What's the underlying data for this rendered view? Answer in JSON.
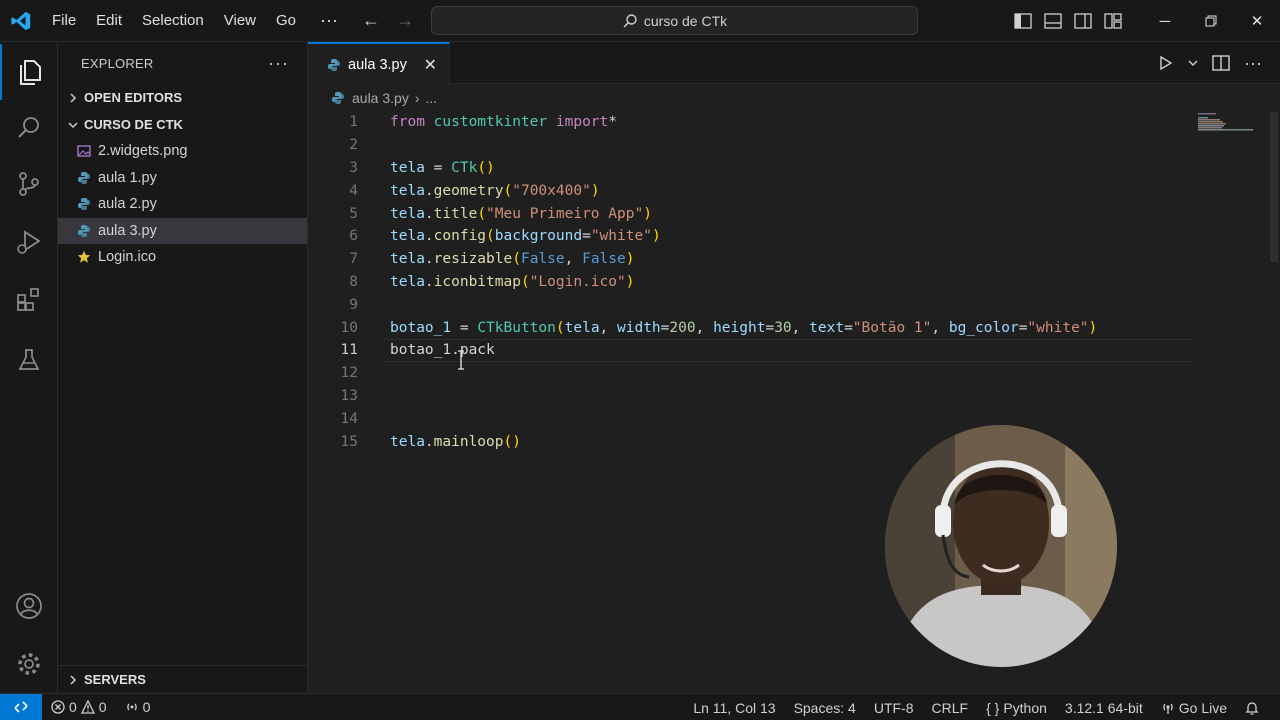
{
  "menu": {
    "items": [
      "File",
      "Edit",
      "Selection",
      "View",
      "Go"
    ],
    "more": "···"
  },
  "search": {
    "text": "curso de CTk"
  },
  "sidebar": {
    "title": "EXPLORER",
    "more": "···",
    "sections": {
      "open_editors": "OPEN EDITORS",
      "folder": "CURSO DE CTK",
      "servers": "SERVERS"
    },
    "files": [
      {
        "name": "2.widgets.png",
        "type": "image"
      },
      {
        "name": "aula 1.py",
        "type": "python"
      },
      {
        "name": "aula 2.py",
        "type": "python"
      },
      {
        "name": "aula 3.py",
        "type": "python",
        "selected": true
      },
      {
        "name": "Login.ico",
        "type": "star"
      }
    ]
  },
  "tab": {
    "label": "aula 3.py"
  },
  "breadcrumb": {
    "file": "aula 3.py",
    "more": "..."
  },
  "code": {
    "current_line": 11,
    "line_numbers": [
      "1",
      "2",
      "3",
      "4",
      "5",
      "6",
      "7",
      "8",
      "9",
      "10",
      "11",
      "12",
      "13",
      "14",
      "15"
    ]
  },
  "statusbar": {
    "errors": "0",
    "warnings": "0",
    "ports": "0",
    "position": "Ln 11, Col 13",
    "spaces": "Spaces: 4",
    "encoding": "UTF-8",
    "eol": "CRLF",
    "language": "Python",
    "interpreter": "3.12.1 64-bit",
    "golive": "Go Live"
  },
  "colors": {
    "accent": "#0078d4",
    "keyword": "#c586c0",
    "string": "#ce9178",
    "function": "#dcdcaa",
    "variable": "#9cdcfe"
  }
}
